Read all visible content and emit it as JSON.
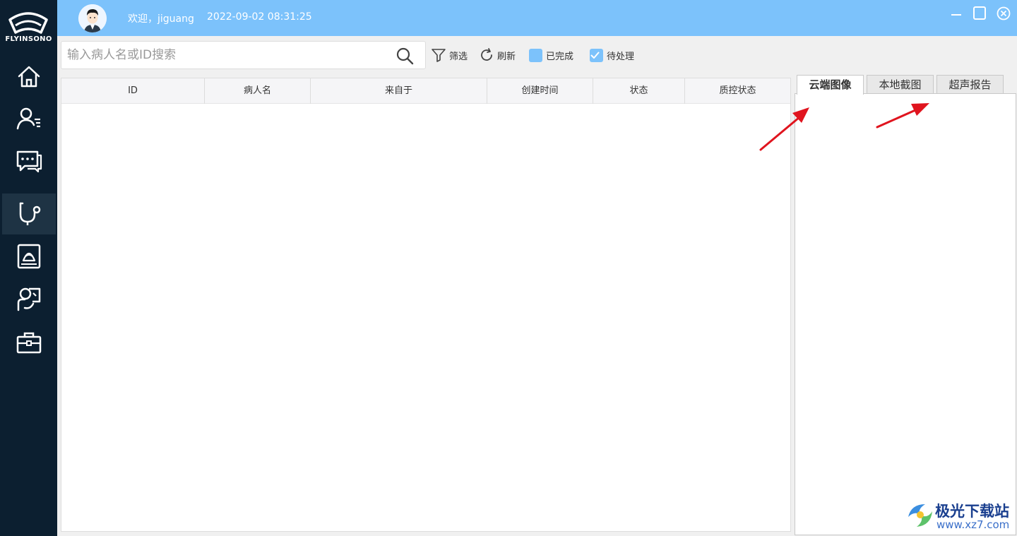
{
  "app": {
    "brand": "FLYINSONO"
  },
  "header": {
    "welcome": "欢迎，jiguang",
    "datetime": "2022-09-02 08:31:25"
  },
  "sidebar": {
    "items": [
      {
        "icon": "home-icon",
        "active": false
      },
      {
        "icon": "patient-list-icon",
        "active": false
      },
      {
        "icon": "messages-icon",
        "active": false
      },
      {
        "icon": "stethoscope-icon",
        "active": true
      },
      {
        "icon": "ultrasound-icon",
        "active": false
      },
      {
        "icon": "consult-icon",
        "active": false
      },
      {
        "icon": "toolbox-icon",
        "active": false
      }
    ]
  },
  "toolbar": {
    "search_placeholder": "输入病人名或ID搜索",
    "filter_label": "筛选",
    "refresh_label": "刷新",
    "completed_label": "已完成",
    "completed_checked": false,
    "pending_label": "待处理",
    "pending_checked": true
  },
  "table": {
    "columns": [
      "ID",
      "病人名",
      "来自于",
      "创建时间",
      "状态",
      "质控状态"
    ],
    "rows": []
  },
  "tabs": {
    "items": [
      "云端图像",
      "本地截图",
      "超声报告"
    ],
    "active": 0
  },
  "watermark": {
    "title": "极光下载站",
    "url": "www.xz7.com"
  },
  "colors": {
    "sidebar_bg": "#0c1f30",
    "header_bg": "#7cc2fb",
    "annotation_arrow": "#e0141e"
  }
}
